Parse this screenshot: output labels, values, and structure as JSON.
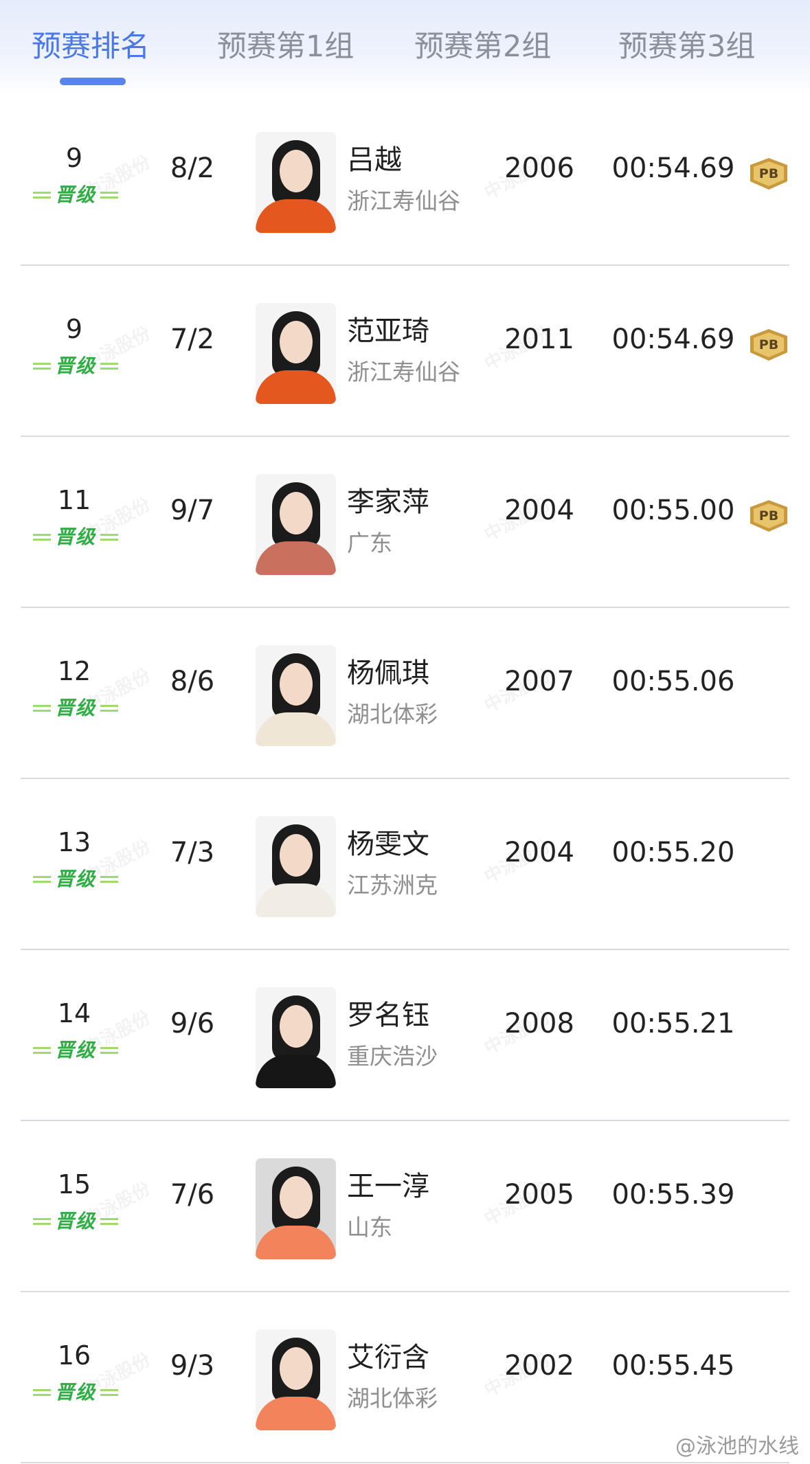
{
  "tabs": [
    {
      "label": "预赛排名",
      "active": true
    },
    {
      "label": "预赛第1组",
      "active": false
    },
    {
      "label": "预赛第2组",
      "active": false
    },
    {
      "label": "预赛第3组",
      "active": false
    }
  ],
  "advance_badge_label": "晋级",
  "pb_badge_label": "PB",
  "row_watermark": "中泳股份",
  "colors": {
    "accent": "#4a78e6",
    "advance": "#2fae43",
    "pb": "#e8c46b"
  },
  "rows": [
    {
      "rank": "9",
      "lane": "8/2",
      "name": "吕越",
      "team": "浙江寿仙谷",
      "year": "2006",
      "time": "00:54.69",
      "pb": true,
      "jersey": "#e4571f"
    },
    {
      "rank": "9",
      "lane": "7/2",
      "name": "范亚琦",
      "team": "浙江寿仙谷",
      "year": "2011",
      "time": "00:54.69",
      "pb": true,
      "jersey": "#e4571f"
    },
    {
      "rank": "11",
      "lane": "9/7",
      "name": "李家萍",
      "team": "广东",
      "year": "2004",
      "time": "00:55.00",
      "pb": true,
      "jersey": "#c9705e"
    },
    {
      "rank": "12",
      "lane": "8/6",
      "name": "杨佩琪",
      "team": "湖北体彩",
      "year": "2007",
      "time": "00:55.06",
      "pb": false,
      "jersey": "#efe6d6"
    },
    {
      "rank": "13",
      "lane": "7/3",
      "name": "杨雯文",
      "team": "江苏洲克",
      "year": "2004",
      "time": "00:55.20",
      "pb": false,
      "jersey": "#f1ece4"
    },
    {
      "rank": "14",
      "lane": "9/6",
      "name": "罗名钰",
      "team": "重庆浩沙",
      "year": "2008",
      "time": "00:55.21",
      "pb": false,
      "jersey": "#161616"
    },
    {
      "rank": "15",
      "lane": "7/6",
      "name": "王一淳",
      "team": "山东",
      "year": "2005",
      "time": "00:55.39",
      "pb": false,
      "jersey": "#f2835a"
    },
    {
      "rank": "16",
      "lane": "9/3",
      "name": "艾衍含",
      "team": "湖北体彩",
      "year": "2002",
      "time": "00:55.45",
      "pb": false,
      "jersey": "#f2835a"
    }
  ],
  "footer_watermark": "@泳池的水线"
}
